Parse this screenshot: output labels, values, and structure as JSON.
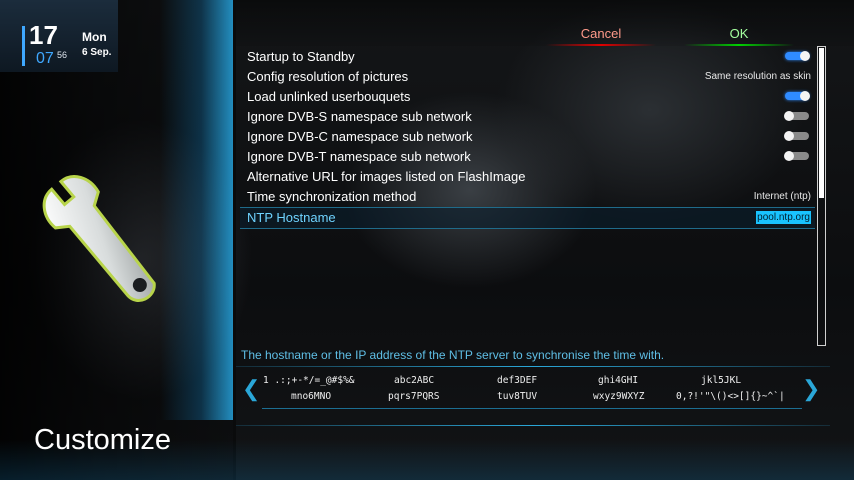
{
  "clock": {
    "hour": "17",
    "minutes": "07",
    "seconds": "56",
    "day": "Mon",
    "date": "6 Sep."
  },
  "screen_title": "Customize",
  "header": {
    "cancel_label": "Cancel",
    "ok_label": "OK",
    "cancel_color": "#e00000",
    "ok_color": "#00d000"
  },
  "settings": [
    {
      "label": "Startup to Standby",
      "type": "toggle",
      "state": "on"
    },
    {
      "label": "Config resolution of pictures",
      "type": "text",
      "value": "Same resolution as skin"
    },
    {
      "label": "Load unlinked userbouquets",
      "type": "toggle",
      "state": "on"
    },
    {
      "label": "Ignore DVB-S namespace sub network",
      "type": "toggle",
      "state": "off"
    },
    {
      "label": "Ignore DVB-C namespace sub network",
      "type": "toggle",
      "state": "off"
    },
    {
      "label": "Ignore DVB-T namespace sub network",
      "type": "toggle",
      "state": "off"
    },
    {
      "label": "Alternative URL for images listed on FlashImage",
      "type": "text",
      "value": ""
    },
    {
      "label": "Time synchronization method",
      "type": "text",
      "value": "Internet (ntp)"
    },
    {
      "label": "NTP Hostname",
      "type": "text",
      "value": "pool.ntp.org",
      "selected": true
    }
  ],
  "help_text": "The hostname or the IP address of the NTP server to synchronise the time with.",
  "keyboard": {
    "row1": [
      "1 .:;+-*/=_@#$%&",
      "abc2ABC",
      "def3DEF",
      "ghi4GHI",
      "jkl5JKL"
    ],
    "row2": [
      "mno6MNO",
      "pqrs7PQRS",
      "tuv8TUV",
      "wxyz9WXYZ",
      "0,?!'\"\\()<>[]{}~^`|"
    ]
  },
  "accent_color": "#2aa7d8",
  "scroll_position": 0.5
}
